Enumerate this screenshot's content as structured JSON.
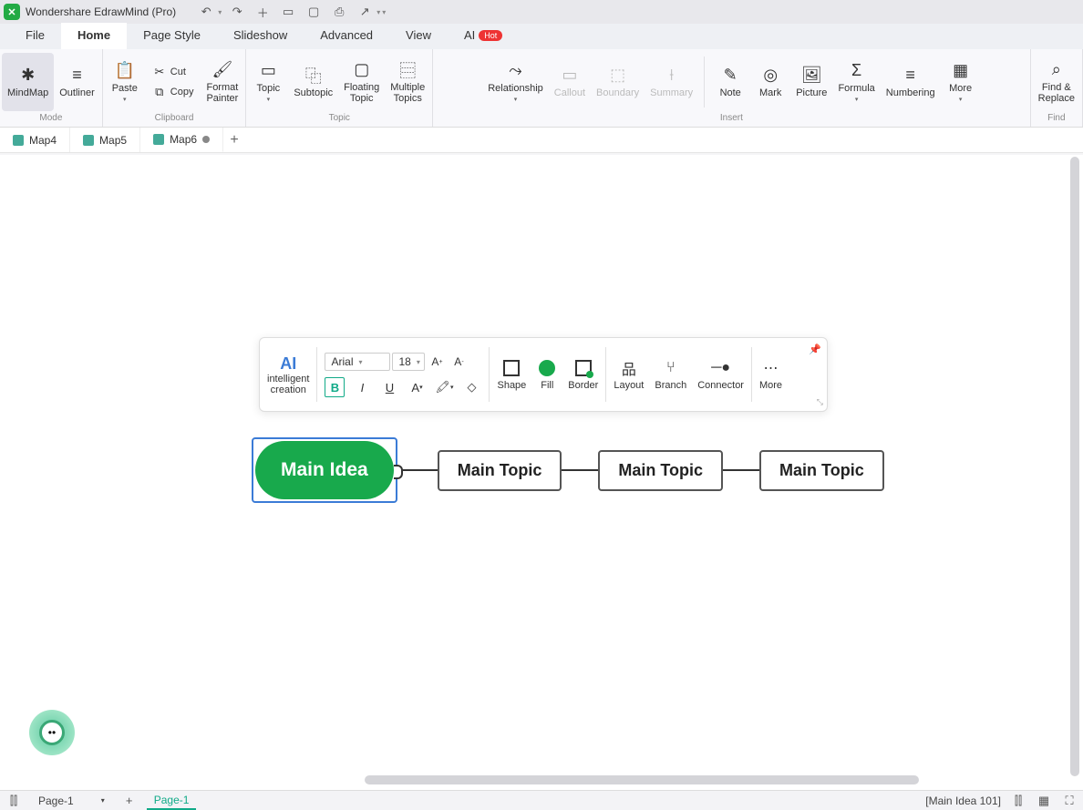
{
  "app": {
    "title": "Wondershare EdrawMind (Pro)"
  },
  "menus": {
    "file": "File",
    "home": "Home",
    "page_style": "Page Style",
    "slideshow": "Slideshow",
    "advanced": "Advanced",
    "view": "View",
    "ai": "AI",
    "hot": "Hot"
  },
  "ribbon": {
    "mode": {
      "mindmap": "MindMap",
      "outliner": "Outliner",
      "label": "Mode"
    },
    "clipboard": {
      "paste": "Paste",
      "cut": "Cut",
      "copy": "Copy",
      "format_painter": "Format\nPainter",
      "label": "Clipboard"
    },
    "topic": {
      "topic": "Topic",
      "subtopic": "Subtopic",
      "floating": "Floating\nTopic",
      "multiple": "Multiple\nTopics",
      "label": "Topic"
    },
    "insert": {
      "relationship": "Relationship",
      "callout": "Callout",
      "boundary": "Boundary",
      "summary": "Summary",
      "note": "Note",
      "mark": "Mark",
      "picture": "Picture",
      "formula": "Formula",
      "numbering": "Numbering",
      "more": "More",
      "label": "Insert"
    },
    "find": {
      "find_replace": "Find &\nReplace",
      "label": "Find"
    }
  },
  "tabs": {
    "t1": "Map4",
    "t2": "Map5",
    "t3": "Map6"
  },
  "float": {
    "ai": "AI",
    "ai_label": "intelligent\ncreation",
    "font": "Arial",
    "size": "18",
    "shape": "Shape",
    "fill": "Fill",
    "border": "Border",
    "layout": "Layout",
    "branch": "Branch",
    "connector": "Connector",
    "more": "More"
  },
  "nodes": {
    "main": "Main Idea",
    "t1": "Main Topic",
    "t2": "Main Topic",
    "t3": "Main Topic"
  },
  "status": {
    "page_sel": "Page-1",
    "page_tab": "Page-1",
    "selection": "[Main Idea 101]"
  }
}
